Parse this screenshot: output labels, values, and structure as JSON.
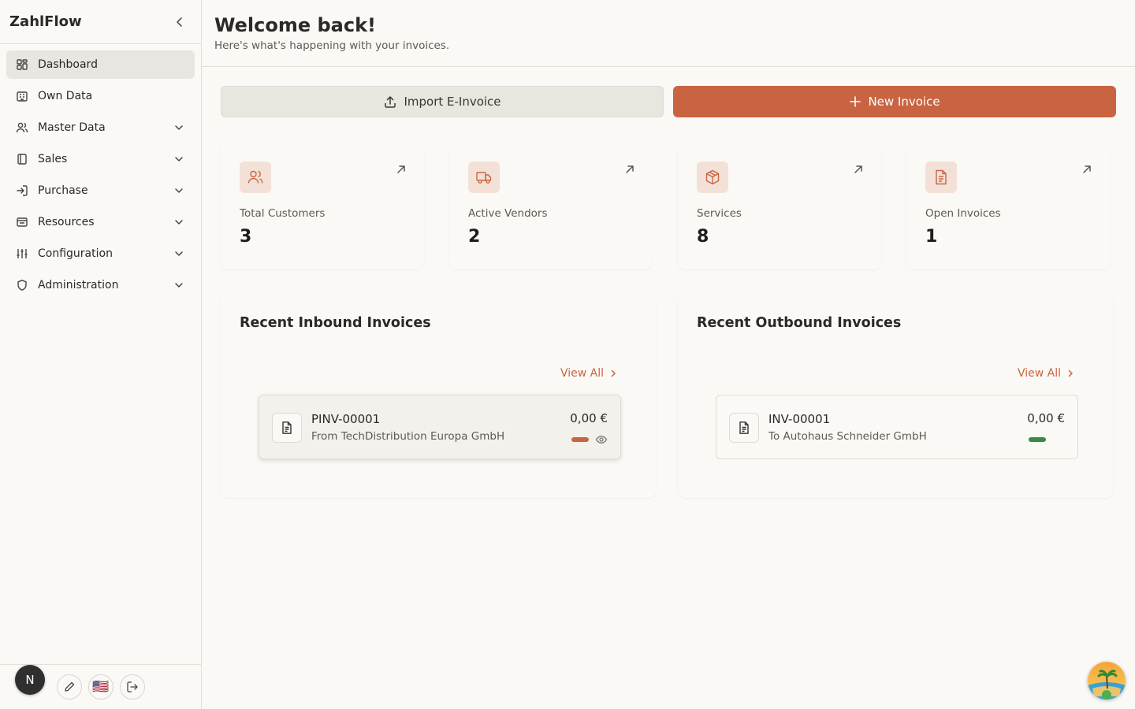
{
  "app": {
    "name": "ZahlFlow"
  },
  "sidebar": {
    "items": [
      {
        "label": "Dashboard",
        "icon": "dashboard-icon",
        "expandable": false,
        "active": true
      },
      {
        "label": "Own Data",
        "icon": "building-icon",
        "expandable": false,
        "active": false
      },
      {
        "label": "Master Data",
        "icon": "users-icon",
        "expandable": true,
        "active": false
      },
      {
        "label": "Sales",
        "icon": "book-icon",
        "expandable": true,
        "active": false
      },
      {
        "label": "Purchase",
        "icon": "login-icon",
        "expandable": true,
        "active": false
      },
      {
        "label": "Resources",
        "icon": "inbox-icon",
        "expandable": true,
        "active": false
      },
      {
        "label": "Configuration",
        "icon": "sliders-icon",
        "expandable": true,
        "active": false
      },
      {
        "label": "Administration",
        "icon": "shield-icon",
        "expandable": true,
        "active": false
      }
    ],
    "footer": {
      "avatar_initial": "N",
      "flag": "🇺🇸"
    }
  },
  "header": {
    "title": "Welcome back!",
    "subtitle": "Here's what's happening with your invoices."
  },
  "actions": {
    "import_label": "Import E-Invoice",
    "new_label": "New Invoice"
  },
  "stats": [
    {
      "label": "Total Customers",
      "value": "3",
      "icon": "users-icon"
    },
    {
      "label": "Active Vendors",
      "value": "2",
      "icon": "truck-icon"
    },
    {
      "label": "Services",
      "value": "8",
      "icon": "box-icon"
    },
    {
      "label": "Open Invoices",
      "value": "1",
      "icon": "document-icon"
    }
  ],
  "inbound": {
    "title": "Recent Inbound Invoices",
    "view_all": "View All",
    "invoices": [
      {
        "number": "PINV-00001",
        "party": "From TechDistribution Europa GmbH",
        "amount": "0,00 €",
        "status_color": "#c96442"
      }
    ]
  },
  "outbound": {
    "title": "Recent Outbound Invoices",
    "view_all": "View All",
    "invoices": [
      {
        "number": "INV-00001",
        "party": "To Autohaus Schneider GmbH",
        "amount": "0,00 €",
        "status_color": "#3a8a3f"
      }
    ]
  },
  "colors": {
    "accent": "#c96442",
    "accent_soft": "#f3e1d8",
    "background": "#faf9f6",
    "success": "#3a8a3f"
  }
}
